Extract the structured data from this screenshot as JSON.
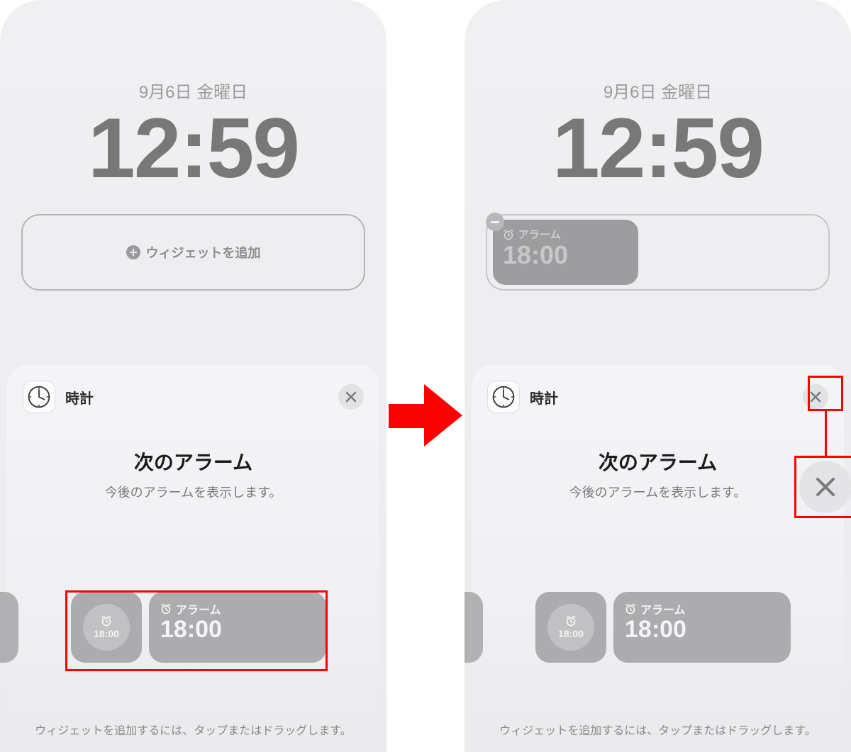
{
  "lockscreen": {
    "date": "9月6日 金曜日",
    "time": "12:59",
    "add_widget_label": "ウィジェットを追加"
  },
  "placed_widget": {
    "label": "アラーム",
    "time": "18:00"
  },
  "sheet": {
    "app_name": "時計",
    "heading": "次のアラーム",
    "subheading": "今後のアラームを表示します。",
    "footer": "ウィジェットを追加するには、タップまたはドラッグします。"
  },
  "widgets": {
    "small_time": "18:00",
    "large_label": "アラーム",
    "large_time": "18:00"
  }
}
